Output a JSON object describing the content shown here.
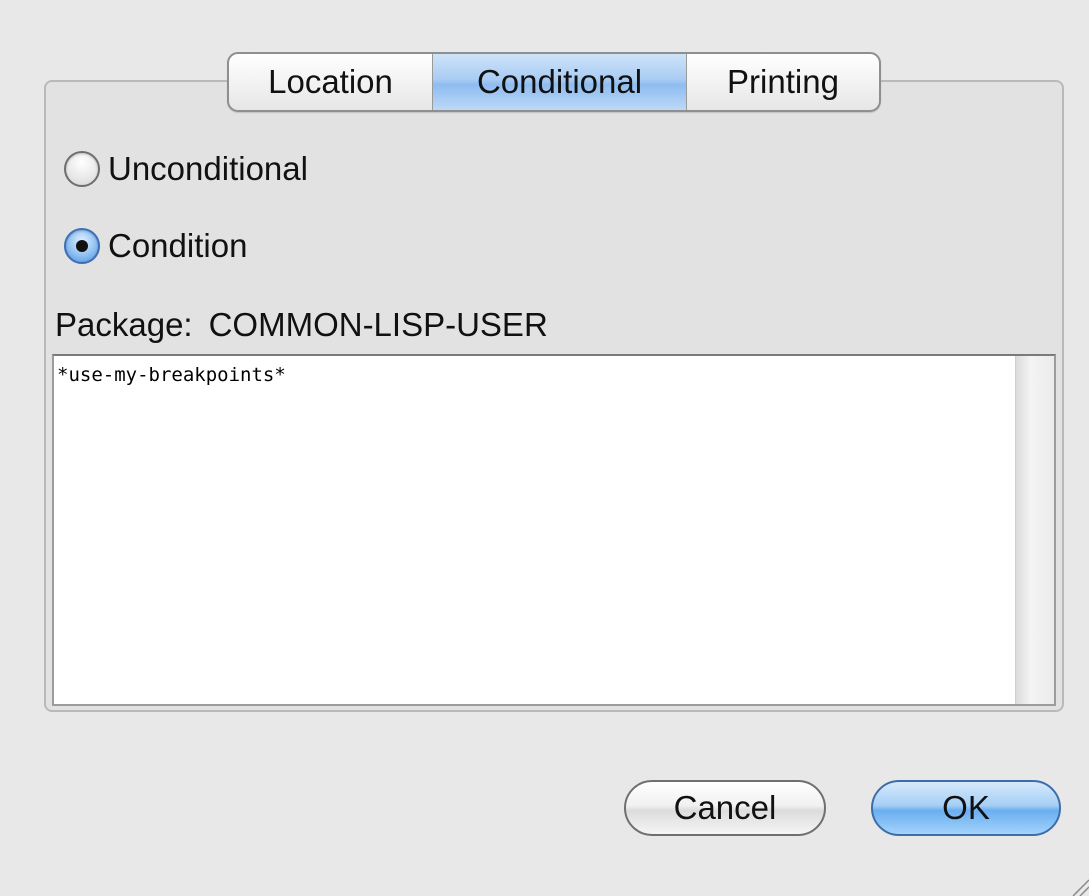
{
  "tabs": [
    {
      "label": "Location",
      "selected": false
    },
    {
      "label": "Conditional",
      "selected": true
    },
    {
      "label": "Printing",
      "selected": false
    }
  ],
  "radios": [
    {
      "label": "Unconditional",
      "selected": false
    },
    {
      "label": "Condition",
      "selected": true
    }
  ],
  "package": {
    "label": "Package:",
    "value": "COMMON-LISP-USER"
  },
  "condition_text": "*use-my-breakpoints*",
  "buttons": {
    "cancel": "Cancel",
    "ok": "OK"
  },
  "colors": {
    "selected_accent": "#8fbcf0",
    "background": "#e8e8e8"
  }
}
